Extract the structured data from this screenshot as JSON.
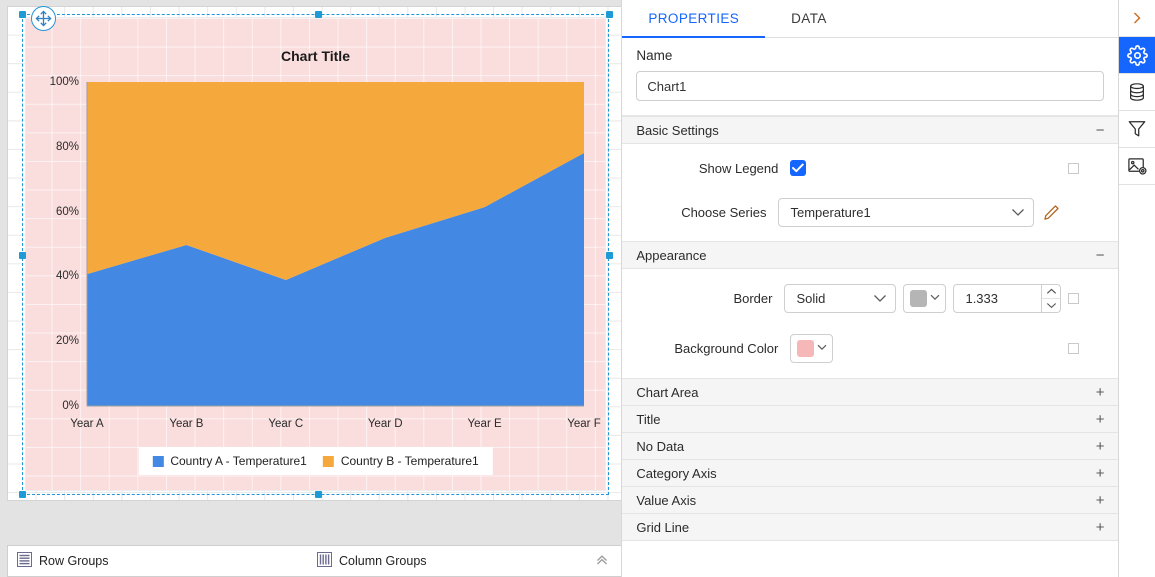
{
  "designer": {
    "chart": {
      "title": "Chart Title",
      "background_color": "#fadddd",
      "series_colors": [
        "#4389e3",
        "#f5a93c"
      ]
    },
    "groups_bar": {
      "row_groups_label": "Row Groups",
      "column_groups_label": "Column Groups",
      "row_groups_icon": "rows-icon",
      "column_groups_icon": "columns-icon",
      "collapse_icon": "chevron-double-up-icon"
    }
  },
  "chart_data": {
    "type": "area",
    "title": "Chart Title",
    "xlabel": "",
    "ylabel": "",
    "stacked": true,
    "percent_stacked": true,
    "grid": false,
    "legend_position": "bottom",
    "ylim": [
      0,
      100
    ],
    "ytick_labels": [
      "0%",
      "20%",
      "40%",
      "60%",
      "80%",
      "100%"
    ],
    "ytick_values": [
      0,
      20,
      40,
      60,
      80,
      100
    ],
    "categories": [
      "Year A",
      "Year B",
      "Year C",
      "Year D",
      "Year E",
      "Year F"
    ],
    "series": [
      {
        "name": "Country A - Temperature1",
        "color": "#4389e3",
        "values": [
          40.7,
          49.7,
          38.9,
          51.9,
          61.4,
          78.1
        ]
      },
      {
        "name": "Country B - Temperature1",
        "color": "#f5a93c",
        "values": [
          59.3,
          50.3,
          61.1,
          48.1,
          38.6,
          21.9
        ]
      }
    ]
  },
  "panel": {
    "tabs": [
      {
        "id": "properties",
        "label": "PROPERTIES",
        "active": true
      },
      {
        "id": "data",
        "label": "DATA",
        "active": false
      }
    ],
    "name": {
      "label": "Name",
      "value": "Chart1",
      "placeholder": "Name"
    },
    "basic_settings": {
      "title": "Basic Settings",
      "toggle_sign": "−",
      "show_legend": {
        "label": "Show Legend",
        "checked": true
      },
      "choose_series": {
        "label": "Choose Series",
        "value": "Temperature1",
        "chevron": "⌄",
        "edit_icon": "pencil-icon"
      }
    },
    "appearance": {
      "title": "Appearance",
      "toggle_sign": "−",
      "border": {
        "label": "Border",
        "style_value": "Solid",
        "color_value": "#b5b5b5",
        "width_value": "1.333"
      },
      "background_color": {
        "label": "Background Color",
        "color_value": "#f5b7b7"
      }
    },
    "collapsed_sections": [
      {
        "label": "Chart Area",
        "sign": "+"
      },
      {
        "label": "Title",
        "sign": "+"
      },
      {
        "label": "No Data",
        "sign": "+"
      },
      {
        "label": "Category Axis",
        "sign": "+"
      },
      {
        "label": "Value Axis",
        "sign": "+"
      },
      {
        "label": "Grid Line",
        "sign": "+"
      }
    ]
  },
  "icon_rail": {
    "items": [
      {
        "id": "expand",
        "icon": "chevron-right-icon",
        "active": false
      },
      {
        "id": "settings",
        "icon": "gear-icon",
        "active": true
      },
      {
        "id": "data-sources",
        "icon": "database-icon",
        "active": false
      },
      {
        "id": "filters",
        "icon": "funnel-icon",
        "active": false
      },
      {
        "id": "image-settings",
        "icon": "image-settings-icon",
        "active": false
      }
    ]
  }
}
